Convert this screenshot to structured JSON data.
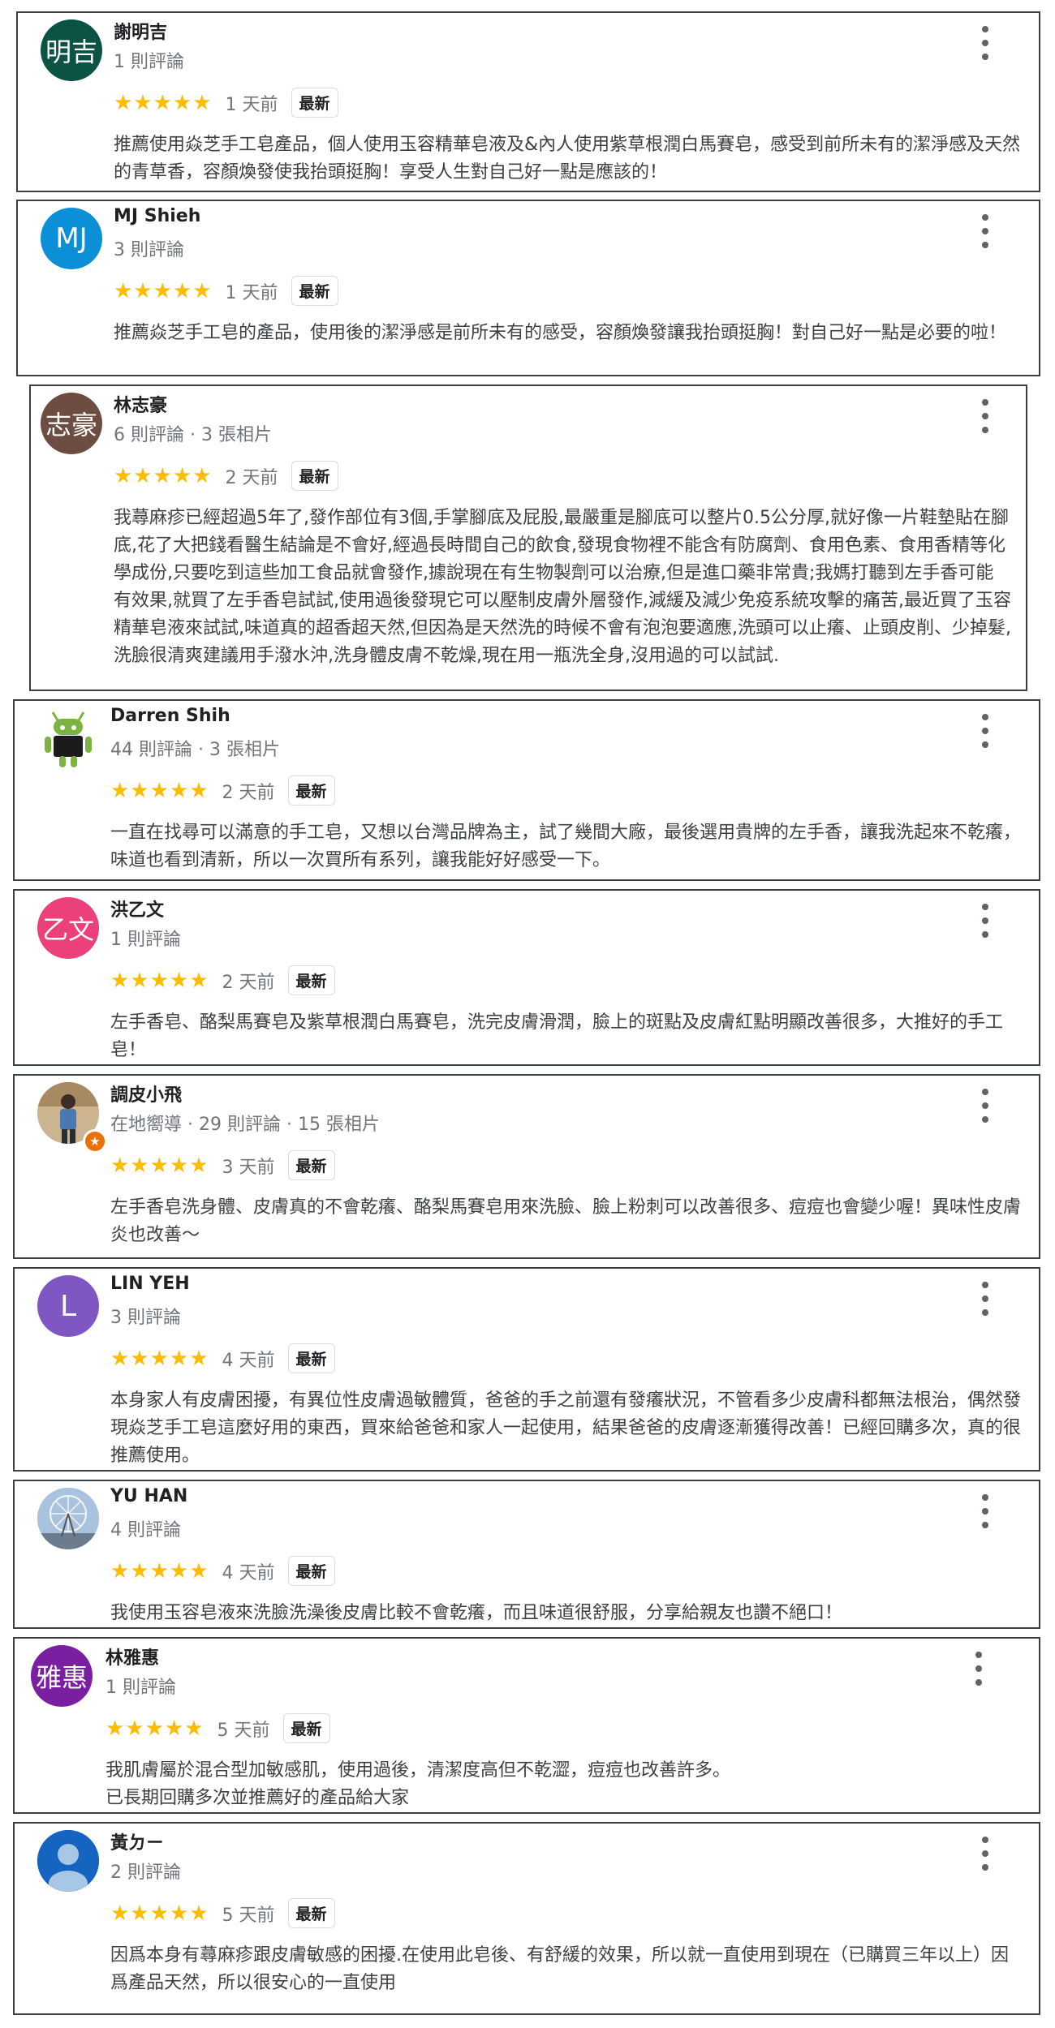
{
  "reviews": [
    {
      "name": "謝明吉",
      "meta": "1 則評論",
      "avatar": {
        "type": "initials",
        "text": "明吉",
        "color": "#0b5345"
      },
      "stars": "★★★★★",
      "date": "1 天前",
      "badge": "最新",
      "text": "推薦使用焱芝手工皂產品，個人使用玉容精華皂液及&內人使用紫草根潤白馬賽皂，感受到前所未有的潔淨感及天然的青草香，容顏煥發使我抬頭挺胸！享受人生對自己好一點是應該的！"
    },
    {
      "name": "MJ Shieh",
      "meta": "3 則評論",
      "avatar": {
        "type": "initials",
        "text": "MJ",
        "color": "#0b8fd6"
      },
      "stars": "★★★★★",
      "date": "1 天前",
      "badge": "最新",
      "text": "推薦焱芝手工皂的產品，使用後的潔淨感是前所未有的感受，容顏煥發讓我抬頭挺胸！對自己好一點是必要的啦！"
    },
    {
      "name": "林志豪",
      "meta": "6 則評論 · 3 張相片",
      "avatar": {
        "type": "initials",
        "text": "志豪",
        "color": "#6d4c41"
      },
      "stars": "★★★★★",
      "date": "2 天前",
      "badge": "最新",
      "text": "我蕁麻疹已經超過5年了,發作部位有3個,手掌腳底及屁股,最嚴重是腳底可以整片0.5公分厚,就好像一片鞋墊貼在腳底,花了大把錢看醫生結論是不會好,經過長時間自己的飲食,發現食物裡不能含有防腐劑、食用色素、食用香精等化學成份,只要吃到這些加工食品就會發作,據說現在有生物製劑可以治療,但是進口藥非常貴;我媽打聽到左手香可能有效果,就買了左手香皂試試,使用過後發現它可以壓制皮膚外層發作,減緩及減少免疫系統攻擊的痛苦,最近買了玉容精華皂液來試試,味道真的超香超天然,但因為是天然洗的時候不會有泡泡要適應,洗頭可以止癢、止頭皮削、少掉髮,洗臉很清爽建議用手潑水沖,洗身體皮膚不乾燥,現在用一瓶洗全身,沒用過的可以試試."
    },
    {
      "name": "Darren Shih",
      "meta": "44 則評論 · 3 張相片",
      "avatar": {
        "type": "android-icon",
        "color": "#7cb342"
      },
      "stars": "★★★★★",
      "date": "2 天前",
      "badge": "最新",
      "text": "一直在找尋可以滿意的手工皂，又想以台灣品牌為主，試了幾間大廠，最後選用貴牌的左手香，讓我洗起來不乾癢，味道也看到清新，所以一次買所有系列，讓我能好好感受一下。"
    },
    {
      "name": "洪乙文",
      "meta": "1 則評論",
      "avatar": {
        "type": "initials",
        "text": "乙文",
        "color": "#ec407a"
      },
      "stars": "★★★★★",
      "date": "2 天前",
      "badge": "最新",
      "text": "左手香皂、酪梨馬賽皂及紫草根潤白馬賽皂，洗完皮膚滑潤，臉上的斑點及皮膚紅點明顯改善很多，大推好的手工皂！"
    },
    {
      "name": "調皮小飛",
      "meta": "在地嚮導 · 29 則評論 · 15 張相片",
      "avatar": {
        "type": "photo-person",
        "color": "#c9b08a"
      },
      "local_guide_icon": "local-guide-star-icon",
      "stars": "★★★★★",
      "date": "3 天前",
      "badge": "最新",
      "text": "左手香皂洗身體、皮膚真的不會乾癢、酪梨馬賽皂用來洗臉、臉上粉刺可以改善很多、痘痘也會變少喔！異味性皮膚炎也改善～"
    },
    {
      "name": "LIN YEH",
      "meta": "3 則評論",
      "avatar": {
        "type": "initials",
        "text": "L",
        "color": "#7e57c2"
      },
      "stars": "★★★★★",
      "date": "4 天前",
      "badge": "最新",
      "text": "本身家人有皮膚困擾，有異位性皮膚過敏體質，爸爸的手之前還有發癢狀況，不管看多少皮膚科都無法根治，偶然發現焱芝手工皂這麼好用的東西，買來給爸爸和家人一起使用，結果爸爸的皮膚逐漸獲得改善！已經回購多次，真的很推薦使用。"
    },
    {
      "name": "YU HAN",
      "meta": "4 則評論",
      "avatar": {
        "type": "photo-ferris-wheel",
        "color": "#9fb8d6"
      },
      "stars": "★★★★★",
      "date": "4 天前",
      "badge": "最新",
      "text": "我使用玉容皂液來洗臉洗澡後皮膚比較不會乾癢，而且味道很舒服，分享給親友也讚不絕口！"
    },
    {
      "name": "林雅惠",
      "meta": "1 則評論",
      "avatar": {
        "type": "initials",
        "text": "雅惠",
        "color": "#7b1fa2"
      },
      "stars": "★★★★★",
      "date": "5 天前",
      "badge": "最新",
      "text": "我肌膚屬於混合型加敏感肌，使用過後，清潔度高但不乾澀，痘痘也改善許多。\n已長期回購多次並推薦好的產品給大家"
    },
    {
      "name": "黃ㄉㄧ",
      "meta": "2 則評論",
      "avatar": {
        "type": "default-person",
        "color": "#1565c0"
      },
      "stars": "★★★★★",
      "date": "5 天前",
      "badge": "最新",
      "text": "因爲本身有蕁麻疹跟皮膚敏感的困擾.在使用此皂後、有舒緩的效果，所以就一直使用到現在（已購買三年以上）因爲產品天然，所以很安心的一直使用"
    }
  ]
}
